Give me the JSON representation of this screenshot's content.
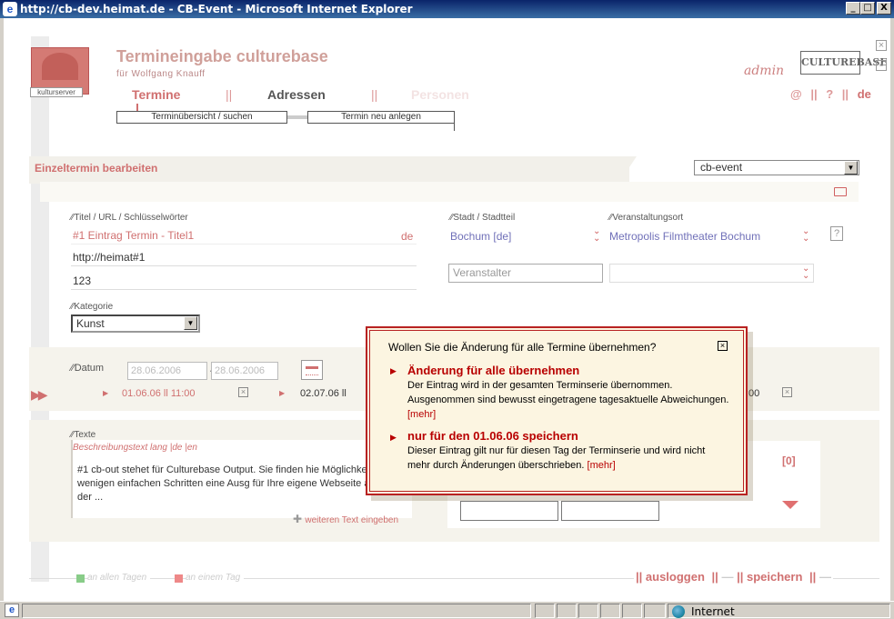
{
  "window": {
    "title": "http://cb-dev.heimat.de - CB-Event - Microsoft Internet Explorer",
    "minimize": "_",
    "maximize": "□",
    "close": "X"
  },
  "header": {
    "logo_label": "kulturserver",
    "app_title": "Termineingabe culturebase",
    "app_subtitle": "für Wolfgang Knauff",
    "brand": "CULTUREBASE",
    "brand_sub": "admin"
  },
  "nav": {
    "items": [
      "Termine",
      "Adressen",
      "Personen"
    ],
    "separator": "||",
    "right": {
      "at": "@",
      "sep": "||",
      "help": "?",
      "lang": "de"
    }
  },
  "subtabs": [
    "Terminübersicht / suchen",
    "Termin neu anlegen"
  ],
  "section": {
    "title": "Einzeltermin bearbeiten",
    "select_value": "cb-event"
  },
  "form": {
    "title_label": "Titel / URL / Schlüsselwörter",
    "title_value": "#1 Eintrag Termin - Titel1",
    "title_lang": "de",
    "url_value": "http://heimat#1",
    "keywords_value": "123",
    "city_label": "Stadt / Stadtteil",
    "city_value": "Bochum [de]",
    "venue_label": "Veranstaltungsort",
    "venue_value": "Metropolis Filmtheater Bochum",
    "help": "?",
    "organizer_placeholder": "Veranstalter",
    "category_label": "Kategorie",
    "category_value": "Kunst"
  },
  "date": {
    "label": "Datum",
    "from": "28.06.2006",
    "dash": "—",
    "to": "28.06.2006",
    "entry1": "01.06.06  ll 11:00",
    "entry2": "02.07.06  ll",
    "entry3": ":00"
  },
  "texts": {
    "label": "Texte",
    "tab": "Beschreibungstext lang |de |en",
    "body": "#1 cb-out stehet für Culturebase Output. Sie finden hie Möglichkeit mit wenigen einfachen Schritten eine Ausg für Ihre eigene Webseite auf Basis der ...",
    "add": "weiteren Text eingeben",
    "counter": "[0]"
  },
  "footer": {
    "legend1": "an allen Tagen",
    "legend2": "an einem Tag",
    "logout": "ausloggen",
    "save": "speichern",
    "sep": "||"
  },
  "dialog": {
    "question": "Wollen Sie die Änderung für alle Termine übernehmen?",
    "option1_title": "Änderung für alle übernehmen",
    "option1_text": "Der Eintrag wird in der gesamten Terminserie übernommen. Ausgenommen sind bewusst eingetragene tagesaktuelle Abweichungen.",
    "option2_title": "nur für den 01.06.06 speichern",
    "option2_text": "Dieser Eintrag gilt nur für diesen Tag der Terminserie und wird nicht mehr durch Änderungen überschrieben.",
    "more": "[mehr]"
  },
  "statusbar": {
    "zone": "Internet"
  },
  "colors": {
    "accent": "#d07070",
    "dialog_border": "#b82222",
    "dialog_bg": "#fcf5e1"
  }
}
